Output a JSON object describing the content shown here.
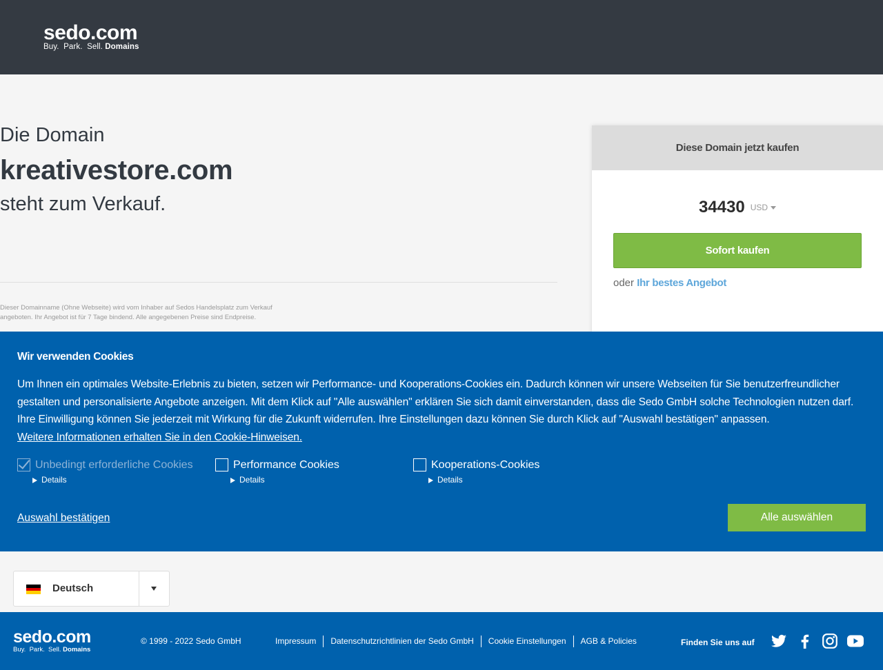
{
  "header": {
    "logo_main": "sedo.com",
    "logo_tag_plain": "Buy.  Park.  Sell.",
    "logo_tag_bold": "Domains"
  },
  "main": {
    "line1": "Die Domain",
    "domain": "kreativestore.com",
    "line3": "steht zum Verkauf.",
    "fineprint": "Dieser Domainname (Ohne Webseite) wird vom Inhaber auf Sedos Handelsplatz zum Verkauf angeboten. Ihr Angebot ist für 7 Tage bindend. Alle angegebenen Preise sind Endpreise."
  },
  "buybox": {
    "title": "Diese Domain jetzt kaufen",
    "price": "34430",
    "currency": "USD",
    "buy_label": "Sofort kaufen",
    "offer_prefix": "oder",
    "offer_link": "Ihr bestes Angebot"
  },
  "cookie": {
    "title": "Wir verwenden Cookies",
    "text": "Um Ihnen ein optimales Website-Erlebnis zu bieten, setzen wir Performance- und Kooperations-Cookies ein. Dadurch können wir unsere Webseiten für Sie benutzerfreundlicher gestalten und personalisierte Angebote anzeigen. Mit dem Klick auf \"Alle auswählen\" erklären Sie sich damit einverstanden, dass die Sedo GmbH solche Technologien nutzen darf. Ihre Einwilligung können Sie jederzeit mit Wirkung für die Zukunft widerrufen. Ihre Einstellungen dazu können Sie durch Klick auf \"Auswahl bestätigen\" anpassen.",
    "more_link": "Weitere Informationen erhalten Sie in den Cookie-Hinweisen.",
    "options": [
      {
        "label": "Unbedingt erforderliche Cookies",
        "details": "Details",
        "checked": true
      },
      {
        "label": "Performance Cookies",
        "details": "Details",
        "checked": false
      },
      {
        "label": "Kooperations-Cookies",
        "details": "Details",
        "checked": false
      }
    ],
    "confirm_label": "Auswahl bestätigen",
    "select_all_label": "Alle auswählen"
  },
  "language": {
    "selected": "Deutsch",
    "flag": "german-flag-icon"
  },
  "footer": {
    "logo_main": "sedo.com",
    "logo_tag_plain": "Buy.  Park.  Sell.",
    "logo_tag_bold": "Domains",
    "copyright": "© 1999 - 2022 Sedo GmbH",
    "links": [
      "Impressum",
      "Datenschutzrichtlinien der Sedo GmbH",
      "Cookie Einstellungen",
      "AGB & Policies"
    ],
    "follow": "Finden Sie uns auf",
    "social": [
      "twitter-icon",
      "facebook-icon",
      "instagram-icon",
      "youtube-icon"
    ]
  },
  "colors": {
    "header_bg": "#343a42",
    "brand_blue": "#0061ad",
    "accent_green": "#7fbb45",
    "link_blue": "#5da6da"
  }
}
